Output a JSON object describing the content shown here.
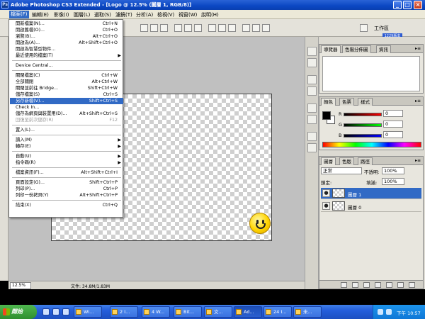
{
  "window": {
    "title": "Adobe Photoshop CS3 Extended - [Logo @ 12.5% (圖層 1, RGB/8)]",
    "min": "_",
    "max": "□",
    "close": "×",
    "app_icon": "Ps"
  },
  "menubar": [
    {
      "label": "檔案(F)",
      "active": true
    },
    {
      "label": "編輯(E)"
    },
    {
      "label": "影像(I)"
    },
    {
      "label": "圖層(L)"
    },
    {
      "label": "選取(S)"
    },
    {
      "label": "濾鏡(T)"
    },
    {
      "label": "分析(A)"
    },
    {
      "label": "檢視(V)"
    },
    {
      "label": "視窗(W)"
    },
    {
      "label": "說明(H)"
    }
  ],
  "optionsbar": {
    "workspace_label": "工作區",
    "version_badge": "1229版本"
  },
  "file_menu": {
    "items": [
      {
        "label": "開新檔案(N)...",
        "shortcut": "Ctrl+N"
      },
      {
        "label": "開啟舊檔(O)...",
        "shortcut": "Ctrl+O"
      },
      {
        "label": "瀏覽(B)...",
        "shortcut": "Alt+Ctrl+O"
      },
      {
        "label": "開啟為(A)...",
        "shortcut": "Alt+Shift+Ctrl+O"
      },
      {
        "label": "開啟為智慧型物件..."
      },
      {
        "label": "最近使用的檔案(T)",
        "submenu": true
      },
      {
        "sep": true
      },
      {
        "label": "Device Central..."
      },
      {
        "sep": true
      },
      {
        "label": "關閉檔案(C)",
        "shortcut": "Ctrl+W"
      },
      {
        "label": "全部關閉",
        "shortcut": "Alt+Ctrl+W"
      },
      {
        "label": "關閉並前往 Bridge...",
        "shortcut": "Shift+Ctrl+W"
      },
      {
        "label": "儲存檔案(S)",
        "shortcut": "Ctrl+S"
      },
      {
        "label": "另存新檔(V)...",
        "shortcut": "Shift+Ctrl+S",
        "highlight": true
      },
      {
        "label": "Check In..."
      },
      {
        "label": "儲存為網頁與裝置用(D)...",
        "shortcut": "Alt+Shift+Ctrl+S"
      },
      {
        "label": "回復至前次儲存(R)",
        "shortcut": "F12",
        "disabled": true
      },
      {
        "sep": true
      },
      {
        "label": "置入(L)..."
      },
      {
        "sep": true
      },
      {
        "label": "讀入(M)",
        "submenu": true
      },
      {
        "label": "轉存(E)",
        "submenu": true
      },
      {
        "sep": true
      },
      {
        "label": "自動(U)",
        "submenu": true
      },
      {
        "label": "指令碼(R)",
        "submenu": true
      },
      {
        "sep": true
      },
      {
        "label": "檔案資訊(F)...",
        "shortcut": "Alt+Shift+Ctrl+I"
      },
      {
        "sep": true
      },
      {
        "label": "頁面設定(G)...",
        "shortcut": "Shift+Ctrl+P"
      },
      {
        "label": "列印(P)...",
        "shortcut": "Ctrl+P"
      },
      {
        "label": "列印一份拷貝(Y)",
        "shortcut": "Alt+Shift+Ctrl+P"
      },
      {
        "sep": true
      },
      {
        "label": "結束(X)",
        "shortcut": "Ctrl+Q"
      }
    ]
  },
  "statusbar": {
    "zoom": "12.5%",
    "docsize": "文件: 34.8M/1.83M"
  },
  "panels": {
    "navigator": {
      "tabs": [
        "導覽器",
        "色階分佈圖",
        "資訊"
      ]
    },
    "color": {
      "tabs": [
        "顏色",
        "色票",
        "樣式"
      ],
      "channels": [
        {
          "label": "R",
          "value": "0"
        },
        {
          "label": "G",
          "value": "0"
        },
        {
          "label": "B",
          "value": "0"
        }
      ],
      "foreground": "#000000",
      "background": "#ffffff"
    },
    "layers": {
      "tabs": [
        "圖層",
        "色版",
        "路徑"
      ],
      "blend_mode": "正常",
      "opacity_label": "不透明:",
      "opacity": "100%",
      "lock_label": "鎖定:",
      "fill_label": "填滿:",
      "fill": "100%",
      "items": [
        {
          "name": "圖層 1",
          "selected": true
        },
        {
          "name": "圖層 0",
          "selected": false
        }
      ]
    }
  },
  "taskbar": {
    "start_label": "開始",
    "tasks": [
      {
        "label": "Wi..."
      },
      {
        "label": "2 I..."
      },
      {
        "label": "4 W..."
      },
      {
        "label": "Bit..."
      },
      {
        "label": "文..."
      },
      {
        "label": "Ad...",
        "active": true
      },
      {
        "label": "24 I..."
      },
      {
        "label": "未..."
      }
    ],
    "clock": "下午 10:57"
  }
}
